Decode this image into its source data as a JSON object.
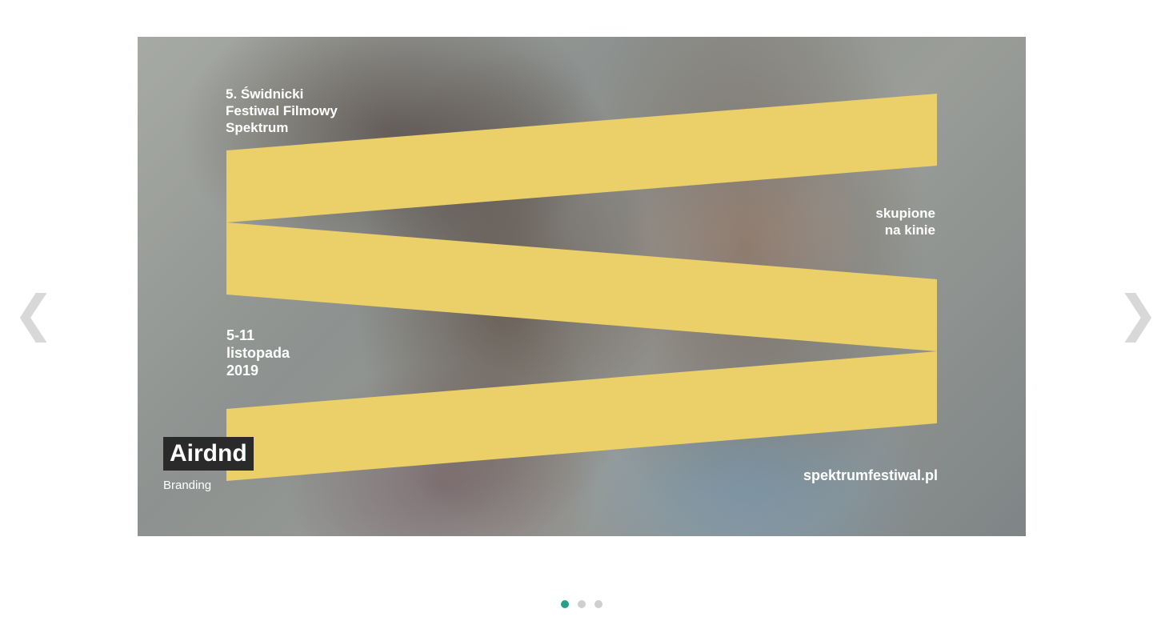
{
  "slider": {
    "prev_arrow": "❮",
    "next_arrow": "❯",
    "active_index": 0,
    "dot_count": 3,
    "colors": {
      "active_dot": "#23a18a",
      "inactive_dot": "#cfcfcf",
      "arrow": "#d8d8d8",
      "band_yellow": "#ebcf68",
      "caption_bg": "#2a2a2a"
    }
  },
  "slide": {
    "poster": {
      "title": "5. Świdnicki\nFestiwal Filmowy\nSpektrum",
      "tagline": "skupione\nna kinie",
      "dates": "5-11\nlistopada\n2019",
      "url": "spektrumfestiwal.pl"
    },
    "caption": {
      "title": "Airdnd",
      "subtitle": "Branding"
    }
  }
}
